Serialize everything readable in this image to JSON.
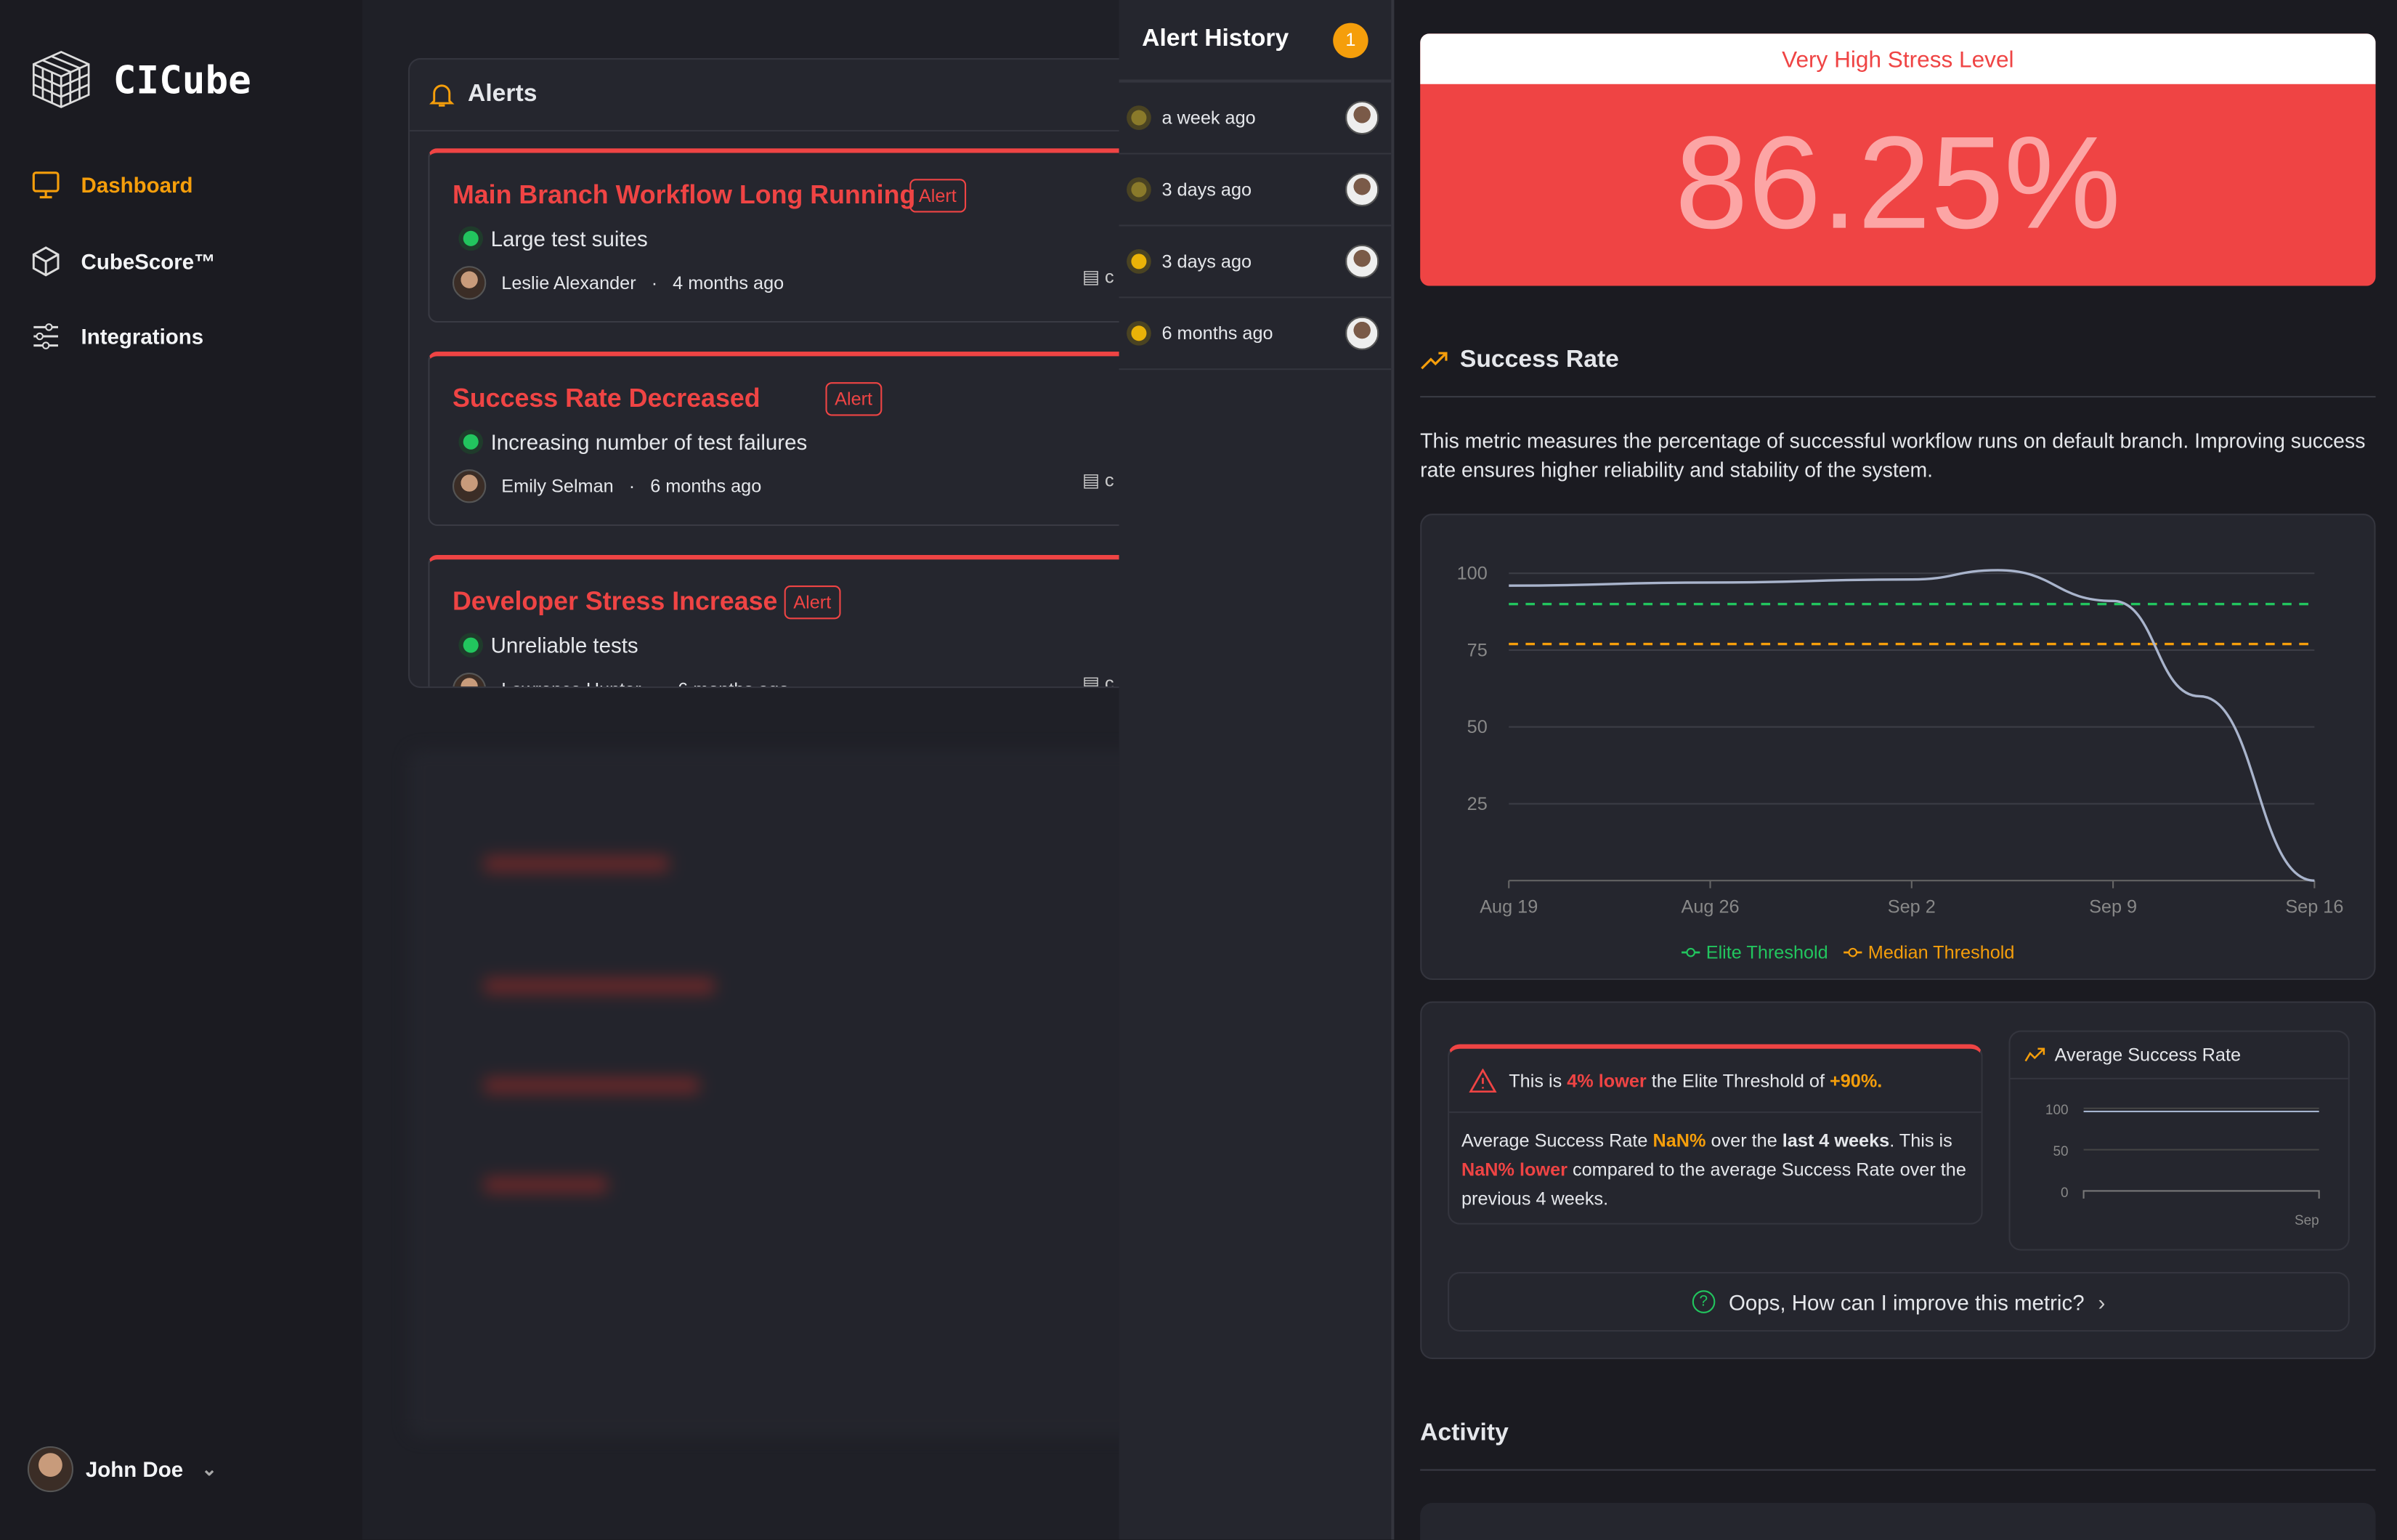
{
  "app": {
    "name": "CICube"
  },
  "sidebar": {
    "items": [
      {
        "label": "Dashboard",
        "icon": "monitor-icon",
        "active": true
      },
      {
        "label": "CubeScore™",
        "icon": "cube-icon"
      },
      {
        "label": "Integrations",
        "icon": "sliders-icon"
      }
    ],
    "user": "John Doe"
  },
  "alerts": {
    "title": "Alerts",
    "items": [
      {
        "title": "Main Branch Workflow Long Running",
        "badge": "Alert",
        "reason": "Large test suites",
        "author": "Leslie Alexander",
        "time": "4 months ago",
        "repo": "c"
      },
      {
        "title": "Success Rate Decreased",
        "badge": "Alert",
        "reason": "Increasing number of test failures",
        "author": "Emily Selman",
        "time": "6 months ago",
        "repo": "c"
      },
      {
        "title": "Developer Stress Increase",
        "badge": "Alert",
        "reason": "Unreliable tests",
        "author": "Lawrence Hunter",
        "time": "6 months ago",
        "repo": "c"
      }
    ]
  },
  "history": {
    "title": "Alert History",
    "count": "1",
    "items": [
      "a week ago",
      "3 days ago",
      "3 days ago",
      "6 months ago"
    ]
  },
  "stress": {
    "label": "Very High Stress Level",
    "value": "86.25%"
  },
  "success": {
    "title": "Success Rate",
    "description": "This metric measures the percentage of successful workflow runs on default branch. Improving success rate ensures higher reliability and stability of the system."
  },
  "chart_data": {
    "type": "line",
    "x": [
      "2024-08-19",
      "2024-08-26",
      "2024-09-02",
      "2024-09-05",
      "2024-09-09",
      "2024-09-12",
      "2024-09-16"
    ],
    "values": [
      96,
      97,
      98,
      101,
      91,
      60,
      0
    ],
    "xticks": [
      "Aug 19",
      "Aug 26",
      "Sep 2",
      "Sep 9",
      "Sep 16"
    ],
    "yticks": [
      25,
      50,
      75,
      100
    ],
    "ylim": [
      0,
      100
    ],
    "thresholds": [
      {
        "name": "Elite Threshold",
        "value": 90,
        "color": "#22c55e"
      },
      {
        "name": "Median Threshold",
        "value": 77,
        "color": "#f59e0b"
      }
    ],
    "grid": true,
    "legend": "bottom"
  },
  "insight": {
    "p1": "This is ",
    "p2": "4% lower",
    "p3": " the Elite Threshold of ",
    "p4": "+90%.",
    "b1": "Average Success Rate ",
    "b2": "NaN%",
    "b3": " over the ",
    "b4": "last 4 weeks",
    "b5": ". This is ",
    "b6": "NaN% lower",
    "b7": " compared to the average Success Rate over the previous 4 weeks."
  },
  "avg_chart": {
    "title": "Average Success Rate",
    "yticks": [
      "100",
      "50",
      "0"
    ],
    "xtick": "Sep"
  },
  "improve": "Oops, How can I improve this metric?",
  "activity": {
    "title": "Activity"
  }
}
